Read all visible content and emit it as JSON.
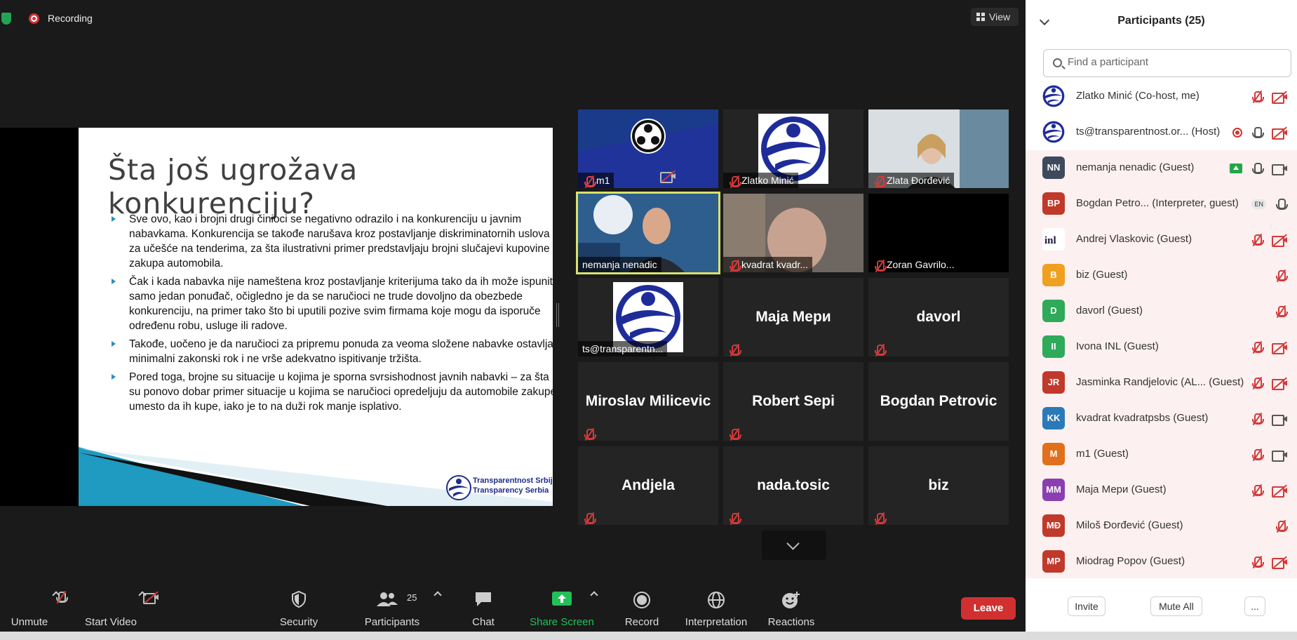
{
  "topbar": {
    "recording_label": "Recording",
    "view_label": "View"
  },
  "slide": {
    "title": "Šta još ugrožava konkurenciju?",
    "bullets": [
      "Sve ovo, kao i brojni drugi činioci se negativno odrazilo i na konkurenciju u javnim nabavkama. Konkurencija se takođe narušava kroz postavljanje diskriminatornih uslova za učešće na tenderima, za šta ilustrativni primer predstavljaju brojni slučajevi kupovine i zakupa automobila.",
      "Čak i kada nabavka nije nameštena kroz postavljanje kriterijuma tako da ih može ispuniti samo jedan ponuđač, očigledno je da se naručioci ne trude dovoljno da obezbede konkurenciju, na primer tako što bi uputili pozive svim firmama koje mogu da isporuče određenu robu, usluge ili radove.",
      "Takođe, uočeno je da naručioci za pripremu ponuda za veoma složene nabavke ostavljaju minimalni zakonski rok i ne vrše adekvatno ispitivanje tržišta.",
      "Pored toga, brojne su situacije u kojima je sporna svrsishodnost javnih nabavki – za šta su ponovo dobar primer situacije u kojima se naručioci opredeljuju da automobile zakupe umesto da ih kupe, iako je to na duži rok manje isplativo."
    ],
    "logo_line1": "Transparentnost Srbija",
    "logo_line2": "Transparency Serbia"
  },
  "tiles": [
    {
      "label": "m1"
    },
    {
      "label": "Zlatko Minić"
    },
    {
      "label": "Zlata Đorđević"
    },
    {
      "label": "nemanja nenadic"
    },
    {
      "label": "kvadrat kvadr..."
    },
    {
      "label": "Zoran Gavrilo..."
    },
    {
      "label": "ts@transparentn..."
    },
    {
      "name": "Maja Мери"
    },
    {
      "name": "davorl"
    },
    {
      "name": "Miroslav Milicevic"
    },
    {
      "name": "Robert Sepi"
    },
    {
      "name": "Bogdan Petrovic"
    },
    {
      "name": "Andjela"
    },
    {
      "name": "nada.tosic"
    },
    {
      "name": "biz"
    }
  ],
  "toolbar": {
    "unmute": "Unmute",
    "start_video": "Start Video",
    "security": "Security",
    "participants": "Participants",
    "participants_count": "25",
    "chat": "Chat",
    "share_screen": "Share Screen",
    "record": "Record",
    "interpretation": "Interpretation",
    "reactions": "Reactions",
    "leave": "Leave"
  },
  "panel": {
    "title": "Participants (25)",
    "search_placeholder": "Find a participant",
    "participants": [
      {
        "name": "Zlatko Minić (Co-host, me)",
        "avatar": "",
        "color": "#ffffff"
      },
      {
        "name": "ts@transparentnost.or...  (Host)",
        "avatar": "",
        "color": "#ffffff"
      },
      {
        "name": "nemanja nenadic (Guest)",
        "avatar": "NN",
        "color": "#3d4a5c"
      },
      {
        "name": "Bogdan Petro...  (Interpreter, guest)",
        "avatar": "BP",
        "color": "#c0392b",
        "badge": "EN"
      },
      {
        "name": "Andrej Vlaskovic (Guest)",
        "avatar": "",
        "color": "#ffffff"
      },
      {
        "name": "biz (Guest)",
        "avatar": "B",
        "color": "#f0a020"
      },
      {
        "name": "davorl (Guest)",
        "avatar": "D",
        "color": "#2eaa5a"
      },
      {
        "name": "Ivona INL (Guest)",
        "avatar": "II",
        "color": "#2eaa5a"
      },
      {
        "name": "Jasminka Randjelovic (AL...  (Guest)",
        "avatar": "JR",
        "color": "#c0392b"
      },
      {
        "name": "kvadrat kvadratpsbs (Guest)",
        "avatar": "KK",
        "color": "#2a7ab8"
      },
      {
        "name": "m1 (Guest)",
        "avatar": "M",
        "color": "#e0701c"
      },
      {
        "name": "Maja Мери (Guest)",
        "avatar": "MM",
        "color": "#8a3fb0"
      },
      {
        "name": "Miloš Đorđević (Guest)",
        "avatar": "MĐ",
        "color": "#c0392b"
      },
      {
        "name": "Miodrag Popov (Guest)",
        "avatar": "MP",
        "color": "#c0392b"
      }
    ],
    "invite": "Invite",
    "mute_all": "Mute All",
    "more": "..."
  }
}
